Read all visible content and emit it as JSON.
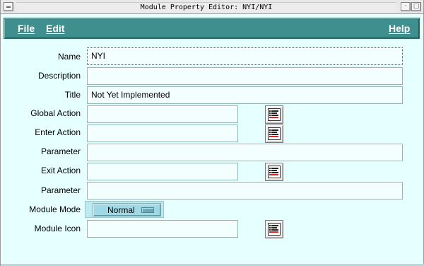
{
  "window": {
    "title": "Module Property Editor: NYI/NYI"
  },
  "menu": {
    "file": "File",
    "edit": "Edit",
    "help": "Help"
  },
  "fields": {
    "name": {
      "label": "Name",
      "value": "NYI"
    },
    "description": {
      "label": "Description",
      "value": ""
    },
    "title": {
      "label": "Title",
      "value": "Not Yet Implemented"
    },
    "global_action": {
      "label": "Global Action",
      "value": ""
    },
    "enter_action": {
      "label": "Enter Action",
      "value": ""
    },
    "enter_parameter": {
      "label": "Parameter",
      "value": ""
    },
    "exit_action": {
      "label": "Exit Action",
      "value": ""
    },
    "exit_parameter": {
      "label": "Parameter",
      "value": ""
    },
    "module_mode": {
      "label": "Module Mode",
      "value": "Normal"
    },
    "module_icon": {
      "label": "Module Icon",
      "value": ""
    }
  },
  "icons": {
    "editor_button": "list-editor-icon",
    "window_menu": "window-menu-icon",
    "minimize": "minimize-icon",
    "maximize": "maximize-icon"
  },
  "colors": {
    "background": "#e6ffff",
    "menubar": "#3f8f8f",
    "menu_text": "#ffffff",
    "field": "#f3ffff",
    "option_menu": "#9fd9e6"
  }
}
